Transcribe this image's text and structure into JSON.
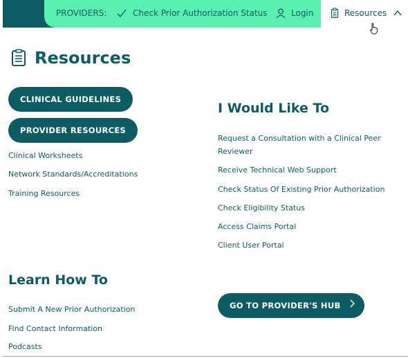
{
  "topbar": {
    "providers_label": "PROVIDERS:",
    "check_status_label": "Check Prior Authorization Status",
    "login_label": "Login",
    "resources_label": "Resources"
  },
  "page": {
    "title": "Resources"
  },
  "left": {
    "buttons": [
      "CLINICAL GUIDELINES",
      "PROVIDER RESOURCES"
    ],
    "links": [
      "Clinical Worksheets",
      "Network Standards/Accreditations",
      "Training Resources"
    ]
  },
  "would_like": {
    "heading": "I Would Like To",
    "links": [
      "Request a Consultation with a Clinical Peer",
      "Reviewer",
      "Receive Technical Web Support",
      "Check Status Of Existing Prior Authorization",
      "Check Eligibility Status",
      "Access Claims Portal",
      "Client User Portal"
    ]
  },
  "learn": {
    "heading": "Learn How To",
    "links": [
      "Submit A New Prior Authorization",
      "Find Contact Information",
      "Podcasts"
    ]
  },
  "hub": {
    "label": "GO TO PROVIDER'S HUB"
  },
  "colors": {
    "brand_dark": "#0d5c63",
    "brand_green": "#59efb1"
  }
}
